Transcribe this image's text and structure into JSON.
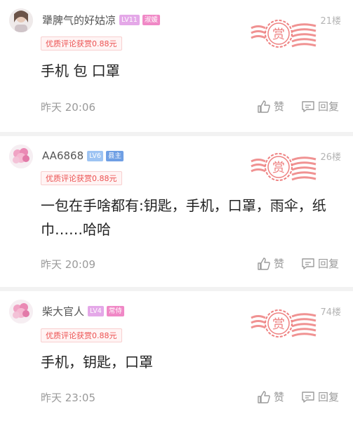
{
  "comments": [
    {
      "username": "犟脾气的好姑凉",
      "badges": [
        {
          "text": "LV11",
          "color": "#e4a8e8"
        },
        {
          "text": "淑媛",
          "color": "#f088c6"
        }
      ],
      "floor": "21楼",
      "reward_tag": "优质评论获赏0.88元",
      "content": "手机 包 口罩",
      "time": "昨天 20:06",
      "like_label": "赞",
      "reply_label": "回复",
      "stamp_text": "赏"
    },
    {
      "username": "AA6868",
      "badges": [
        {
          "text": "LV6",
          "color": "#9ec4f3"
        },
        {
          "text": "县主",
          "color": "#6f9fe4"
        }
      ],
      "floor": "26楼",
      "reward_tag": "优质评论获赏0.88元",
      "content": "一包在手啥都有:钥匙，手机，口罩，雨伞，纸巾……哈哈",
      "time": "昨天 20:09",
      "like_label": "赞",
      "reply_label": "回复",
      "stamp_text": "赏"
    },
    {
      "username": "柴大官人",
      "badges": [
        {
          "text": "LV4",
          "color": "#e4a8e8"
        },
        {
          "text": "常侍",
          "color": "#f088c6"
        }
      ],
      "floor": "74楼",
      "reward_tag": "优质评论获赏0.88元",
      "content": "手机，钥匙，口罩",
      "time": "昨天 23:05",
      "like_label": "赞",
      "reply_label": "回复",
      "stamp_text": "赏"
    }
  ],
  "colors": {
    "reward_red": "#ec5151",
    "stamp_red": "#ee8080",
    "separator": "#f2f2f2",
    "muted_text": "#9a9a9a"
  },
  "icons": [
    "thumbs-up-icon",
    "comment-bubble-icon",
    "reward-stamp-icon"
  ]
}
